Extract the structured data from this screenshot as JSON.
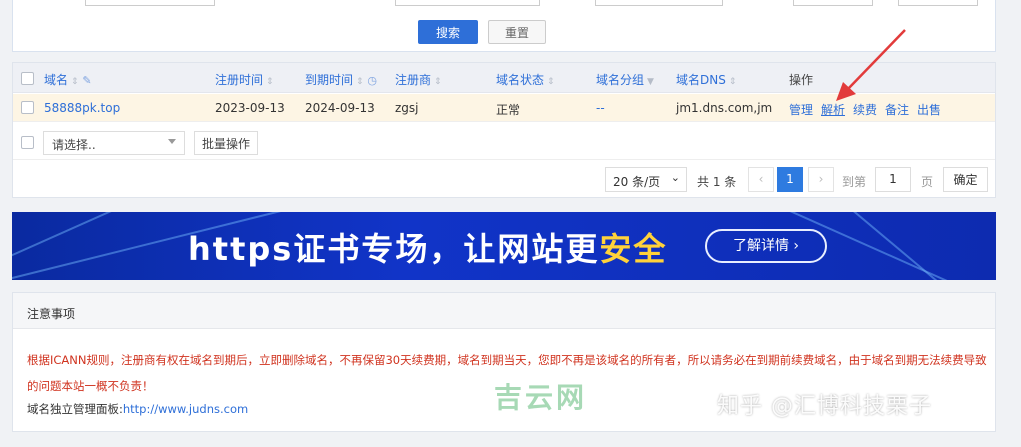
{
  "filter": {
    "search_label": "搜索",
    "reset_label": "重置"
  },
  "table": {
    "headers": {
      "domain": "域名",
      "reg_time": "注册时间",
      "expire_time": "到期时间",
      "registrar": "注册商",
      "status": "域名状态",
      "group": "域名分组",
      "dns": "域名DNS",
      "action": "操作"
    },
    "rows": [
      {
        "domain": "58888pk.top",
        "reg_time": "2023-09-13",
        "expire_time": "2024-09-13",
        "registrar": "zgsj",
        "status": "正常",
        "group": "--",
        "dns": "jm1.dns.com,jm",
        "actions": [
          "管理",
          "解析",
          "续费",
          "备注",
          "出售"
        ]
      }
    ],
    "batch_select_placeholder": "请选择..",
    "batch_button": "批量操作"
  },
  "pager": {
    "page_size": "20 条/页",
    "total": "共 1 条",
    "prev": "‹",
    "current": "1",
    "next": "›",
    "goto_label": "到第",
    "goto_value": "1",
    "page_unit": "页",
    "confirm": "确定"
  },
  "banner": {
    "title_prefix": "https证书专场，让网站更",
    "title_highlight": "安全",
    "button": "了解详情 ›"
  },
  "notes": {
    "title": "注意事项",
    "warning": "根据ICANN规则，注册商有权在域名到期后，立即删除域名，不再保留30天续费期，域名到期当天，您即不再是该域名的所有者，所以请务必在到期前续费域名，由于域名到期无法续费导致的问题本站一概不负责！",
    "mgmt_label": "域名独立管理面板:",
    "mgmt_url": "http://www.judns.com"
  },
  "watermarks": {
    "left": "吉云网",
    "right": "知乎 @汇博科技栗子"
  },
  "colors": {
    "primary": "#2e6fd8",
    "warning_text": "#d0331f",
    "highlight_row": "#fdf5e4",
    "arrow": "#e23b3b"
  }
}
